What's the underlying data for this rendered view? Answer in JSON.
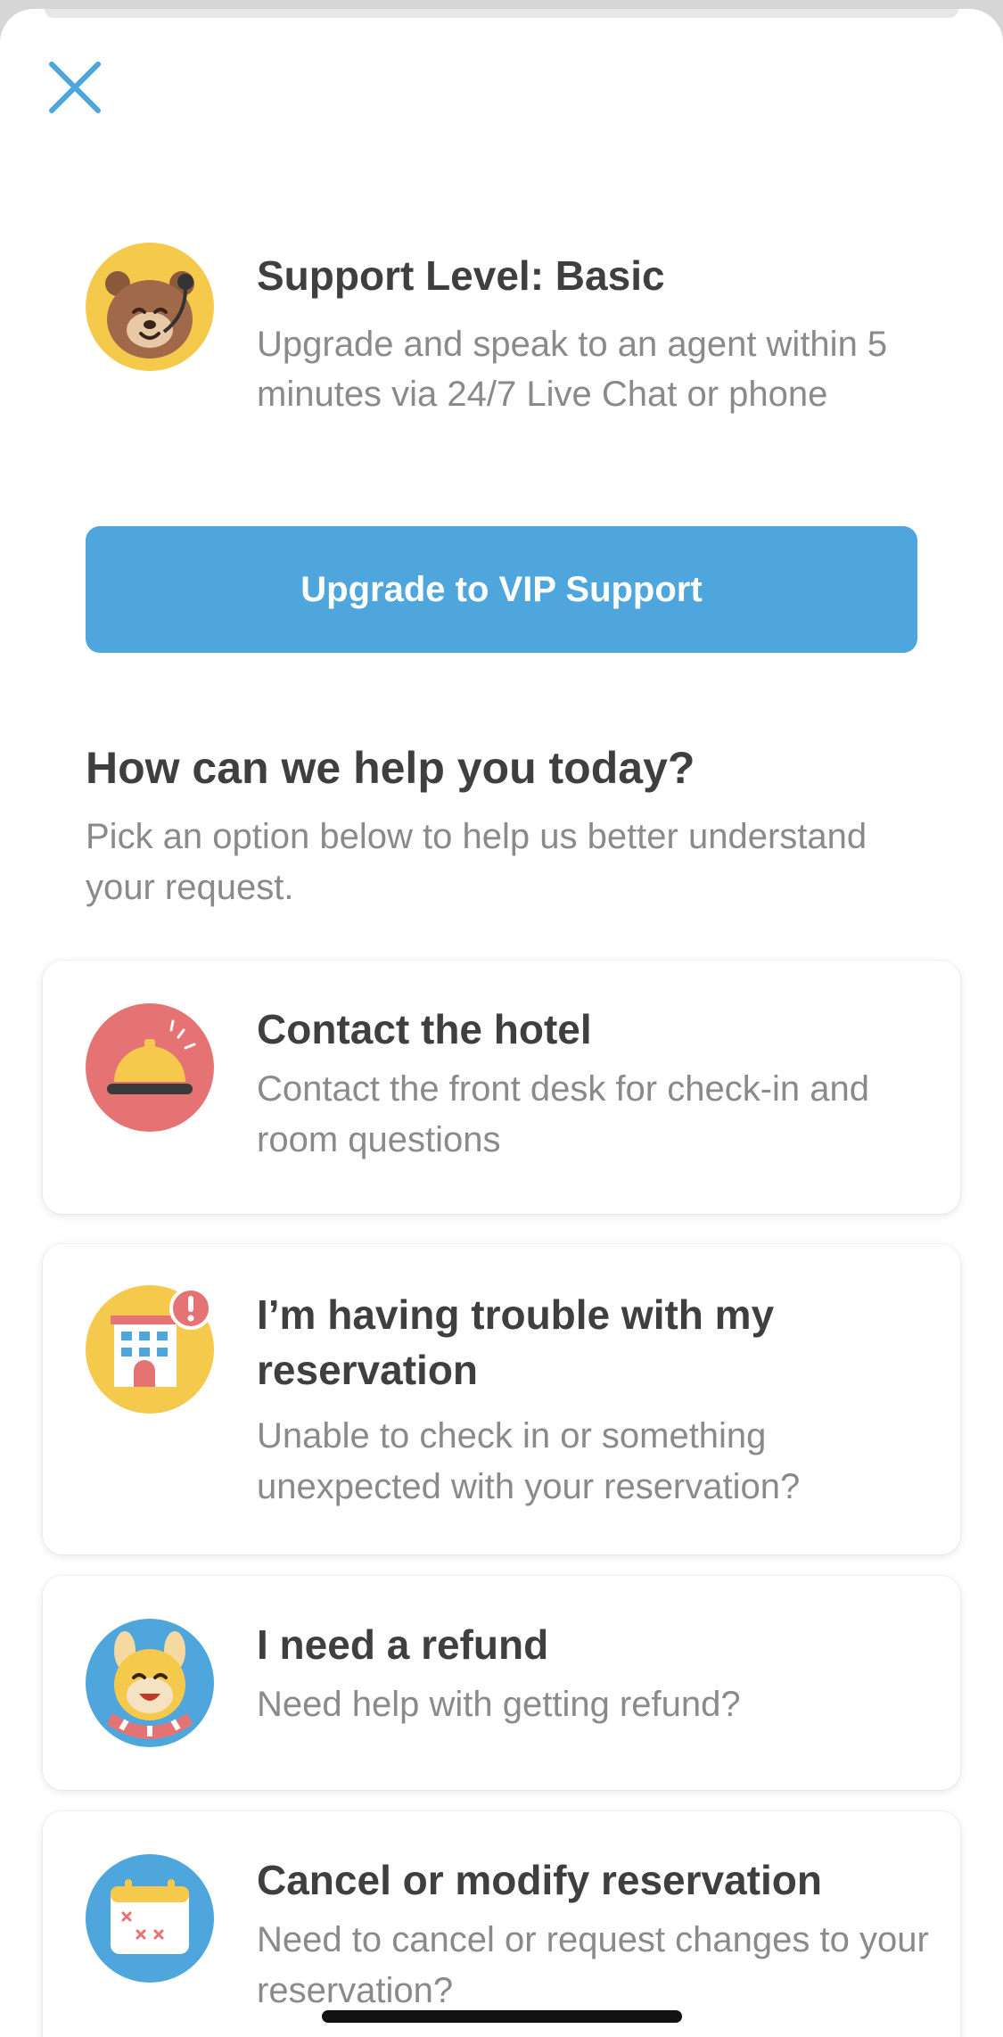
{
  "header": {
    "close_icon": "close-icon"
  },
  "support": {
    "avatar_icon": "bear-support-avatar",
    "title": "Support Level: Basic",
    "description": "Upgrade and speak to an agent within 5 minutes via 24/7 Live Chat or phone",
    "upgrade_label": "Upgrade to VIP Support"
  },
  "help": {
    "title": "How can we help you today?",
    "subtitle": "Pick an option below to help us better understand your request."
  },
  "options": [
    {
      "icon": "bell-icon",
      "title": "Contact the hotel",
      "description": "Contact the front desk for check-in and room questions"
    },
    {
      "icon": "hotel-alert-icon",
      "title": "I’m having trouble with my reservation",
      "description": "Unable to check in or something unexpected with your reservation?"
    },
    {
      "icon": "refund-mascot-icon",
      "title": "I need a refund",
      "description": "Need help with getting refund?"
    },
    {
      "icon": "calendar-icon",
      "title": "Cancel or modify reservation",
      "description": "Need to cancel or request changes to your reservation?"
    }
  ],
  "colors": {
    "accent": "#4ea6dc",
    "title_text": "#3f3f3f",
    "body_text": "#8a8a8a",
    "bell_bg": "#e57373",
    "yellow_bg": "#f5c94b",
    "blue_bg": "#4ea6dc"
  }
}
